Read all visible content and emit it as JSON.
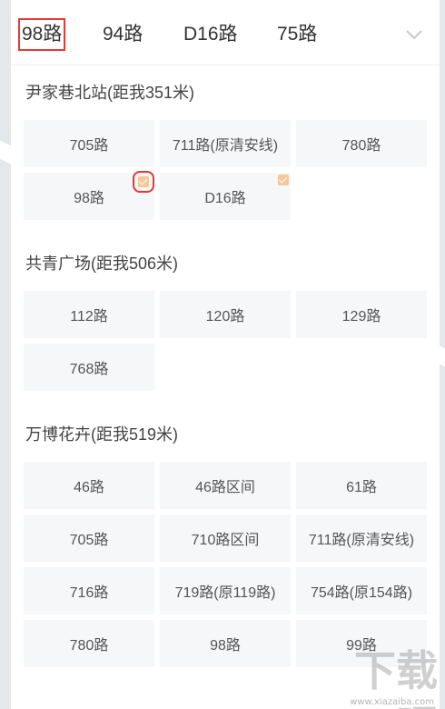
{
  "tabs": [
    {
      "label": "98路",
      "active": true
    },
    {
      "label": "94路",
      "active": false
    },
    {
      "label": "D16路",
      "active": false
    },
    {
      "label": "75路",
      "active": false
    }
  ],
  "stops": [
    {
      "title": "尹家巷北站(距我351米)",
      "routes": [
        {
          "label": "705路",
          "checked": false
        },
        {
          "label": "711路(原清安线)",
          "checked": false
        },
        {
          "label": "780路",
          "checked": false
        },
        {
          "label": "98路",
          "checked": true
        },
        {
          "label": "D16路",
          "checked": true
        }
      ]
    },
    {
      "title": "共青广场(距我506米)",
      "routes": [
        {
          "label": "112路",
          "checked": false
        },
        {
          "label": "120路",
          "checked": false
        },
        {
          "label": "129路",
          "checked": false
        },
        {
          "label": "768路",
          "checked": false
        }
      ]
    },
    {
      "title": "万博花卉(距我519米)",
      "routes": [
        {
          "label": "46路",
          "checked": false
        },
        {
          "label": "46路区间",
          "checked": false
        },
        {
          "label": "61路",
          "checked": false
        },
        {
          "label": "705路",
          "checked": false
        },
        {
          "label": "710路区间",
          "checked": false
        },
        {
          "label": "711路(原清安线)",
          "checked": false
        },
        {
          "label": "716路",
          "checked": false
        },
        {
          "label": "719路(原119路)",
          "checked": false
        },
        {
          "label": "754路(原154路)",
          "checked": false
        },
        {
          "label": "780路",
          "checked": false
        },
        {
          "label": "98路",
          "checked": false
        },
        {
          "label": "99路",
          "checked": false
        }
      ]
    }
  ],
  "watermark": {
    "text": "下载吧",
    "url": "www.xiazaiba.com"
  },
  "icons": {
    "expand": "chevron-down-icon",
    "check": "check-icon"
  },
  "colors": {
    "highlight": "#e53935",
    "check": "#f7c799",
    "tile": "#f6f7f9"
  }
}
